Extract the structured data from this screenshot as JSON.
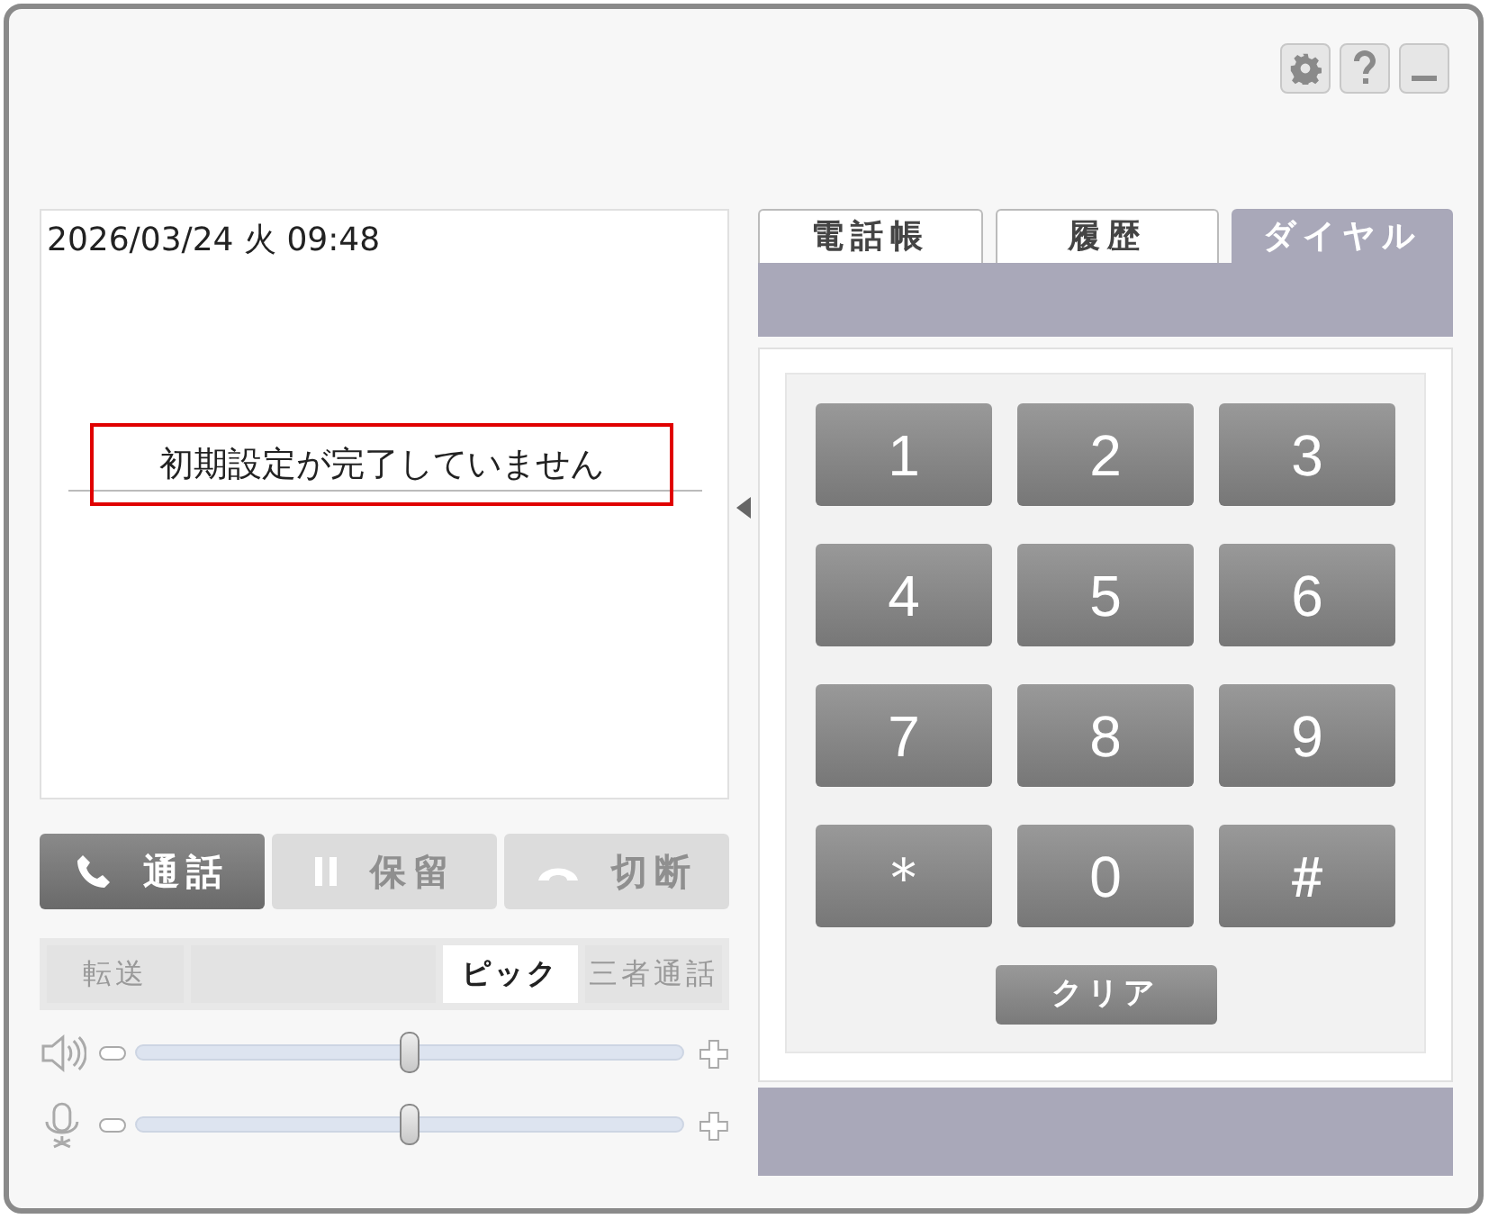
{
  "display": {
    "datetime": "2026/03/24 火 09:48",
    "message": "初期設定が完了していません",
    "message_highlighted": true
  },
  "call_buttons": [
    {
      "kind": "call",
      "label": "通話",
      "disabled": false
    },
    {
      "kind": "hold",
      "label": "保留",
      "disabled": true
    },
    {
      "kind": "hangup",
      "label": "切断",
      "disabled": true
    }
  ],
  "options": [
    {
      "label": "転送",
      "selected": false,
      "disabled": true
    },
    {
      "selected": false
    },
    {
      "label": "ピック",
      "selected": true,
      "disabled": false
    },
    {
      "label": "三者通話",
      "selected": false,
      "disabled": true
    }
  ],
  "volumes": [
    {
      "kind": "speaker",
      "level": 0.5
    },
    {
      "kind": "mic",
      "level": 0.5
    }
  ],
  "tabs": [
    {
      "label": "電話帳",
      "selected": false
    },
    {
      "label": "履歴",
      "selected": false
    },
    {
      "label": "ダイヤル",
      "selected": true
    }
  ],
  "keypad": {
    "keys": [
      "1",
      "2",
      "3",
      "4",
      "5",
      "6",
      "7",
      "8",
      "9",
      "＊",
      "0",
      "＃"
    ],
    "clear": "クリア"
  }
}
